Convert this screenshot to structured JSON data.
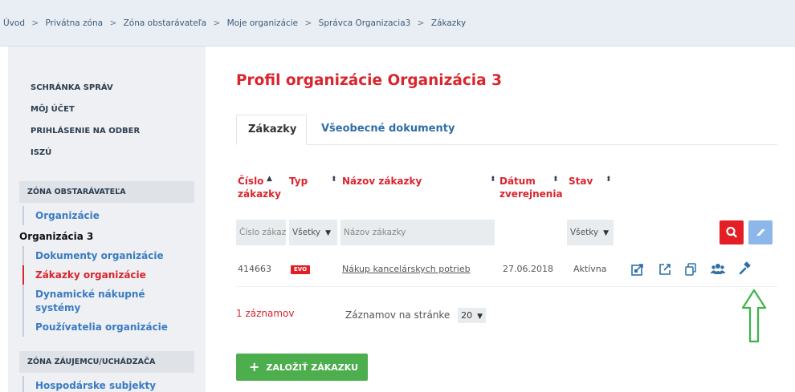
{
  "breadcrumb": [
    "Úvod",
    "Privátna zóna",
    "Zóna obstarávateľa",
    "Moje organizácie",
    "Správca Organizacia3",
    "Zákazky"
  ],
  "breadcrumb_sep": ">",
  "sidebar": {
    "top_links": [
      "SCHRÁNKA SPRÁV",
      "MÔJ ÚČET",
      "PRIHLÁSENIE NA ODBER",
      "ISZÚ"
    ],
    "section1_title": "ZÓNA OBSTARÁVATEĽA",
    "section1_items": {
      "organizacie": "Organizácie",
      "org3": "Organizácia 3",
      "dokumenty": "Dokumenty organizácie",
      "zakazky": "Zákazky organizácie",
      "dns": "Dynamické nákupné systémy",
      "pouzivatelia": "Používatelia organizácie"
    },
    "section2_title": "ZÓNA ZÁUJEMCU/UCHÁDZAČA",
    "section2_items": {
      "hospodarske": "Hospodárske subjekty"
    }
  },
  "main": {
    "title": "Profil organizácie Organizácia 3",
    "tabs": {
      "active": "Zákazky",
      "other": "Všeobecné dokumenty"
    },
    "columns": {
      "cislo": "Číslo zákazky",
      "typ": "Typ",
      "nazov": "Názov zákazky",
      "datum": "Dátum zverejnenia",
      "stav": "Stav"
    },
    "filters": {
      "cislo_placeholder": "Číslo zákazky",
      "typ_value": "Všetky",
      "nazov_placeholder": "Názov zákazky",
      "stav_value": "Všetky"
    },
    "rows": [
      {
        "cislo": "414663",
        "typ": "EVO",
        "nazov": "Nákup kancelárskych potrieb",
        "datum": "27.06.2018",
        "stav": "Aktívna"
      }
    ],
    "record_count": "1 záznamov",
    "per_page_label": "Záznamov na stránke",
    "per_page_value": "20",
    "create_button": "ZALOŽIŤ ZÁKAZKU"
  },
  "colors": {
    "accent_red": "#d9252d",
    "link_blue": "#3b7bc4",
    "green": "#4cae4c",
    "annotation_arrow": "#3bb54a"
  },
  "icons": [
    "external-edit-icon",
    "open-link-icon",
    "copy-icon",
    "users-icon",
    "gavel-icon",
    "search-icon",
    "eraser-icon"
  ]
}
